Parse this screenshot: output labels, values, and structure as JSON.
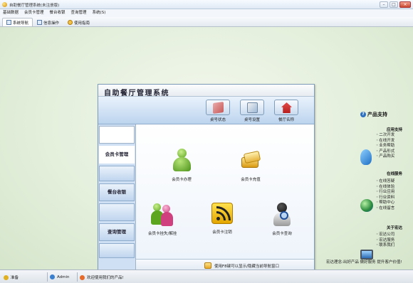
{
  "window": {
    "title": "自助餐厅管理系统(未注册版)",
    "controls": [
      "–",
      "□",
      "×"
    ]
  },
  "menubar": [
    "基础数据",
    "会员卡管理",
    "餐台收银",
    "查询管理",
    "系统(S)"
  ],
  "tabs": [
    {
      "label": "系统导航",
      "icon": "navigation-icon"
    },
    {
      "label": "信息操作",
      "icon": "info-operation-icon"
    },
    {
      "label": "使用指南",
      "icon": "help-guide-icon"
    }
  ],
  "panel": {
    "title": "自助餐厅管理系统",
    "toolbar": [
      {
        "label": "桌号状态",
        "icon": "table-status-icon"
      },
      {
        "label": "桌号设置",
        "icon": "table-setting-icon"
      },
      {
        "label": "餐厅名称",
        "icon": "restaurant-name-icon"
      }
    ],
    "nav": {
      "items": [
        "会员卡管理",
        "餐台收银",
        "查询管理"
      ]
    },
    "functions": [
      {
        "label": "会员卡办理",
        "icon": "member-card-apply-icon"
      },
      {
        "label": "会员卡充值",
        "icon": "member-card-recharge-icon"
      },
      {
        "label": "会员卡挂失/解挂",
        "icon": "member-card-loss-icon"
      },
      {
        "label": "会员卡注销",
        "icon": "member-card-cancel-icon"
      },
      {
        "label": "会员卡查询",
        "icon": "member-card-query-icon"
      }
    ],
    "hint": "使用F8键可以显示/隐藏当前导航窗口"
  },
  "support": {
    "title": "产品支持",
    "sections": [
      {
        "heading": "应用支持",
        "items": [
          "二次开发",
          "在线开发",
          "业务帮助",
          "产品形式",
          "产品购买"
        ],
        "icon": "application-support-icon"
      },
      {
        "heading": "在线服务",
        "items": [
          "在线答疑",
          "在线体验",
          "行业应用",
          "行业资料",
          "帮助中心",
          "在线留言"
        ],
        "icon": "online-service-icon"
      },
      {
        "heading": "关于宏达",
        "items": [
          "宏达公司",
          "宏达服务",
          "联系我们"
        ],
        "icon": "about-hongda-icon"
      }
    ],
    "footer": "宏达理念:出好产品 做好服务 提升客户价值!"
  },
  "statusbar": {
    "segments": [
      {
        "text": "准备",
        "icon": "ready-icon"
      },
      {
        "text": "Admin",
        "icon": "user-icon"
      },
      {
        "text": "欢迎使用我们的产品!",
        "icon": "welcome-icon"
      }
    ]
  }
}
